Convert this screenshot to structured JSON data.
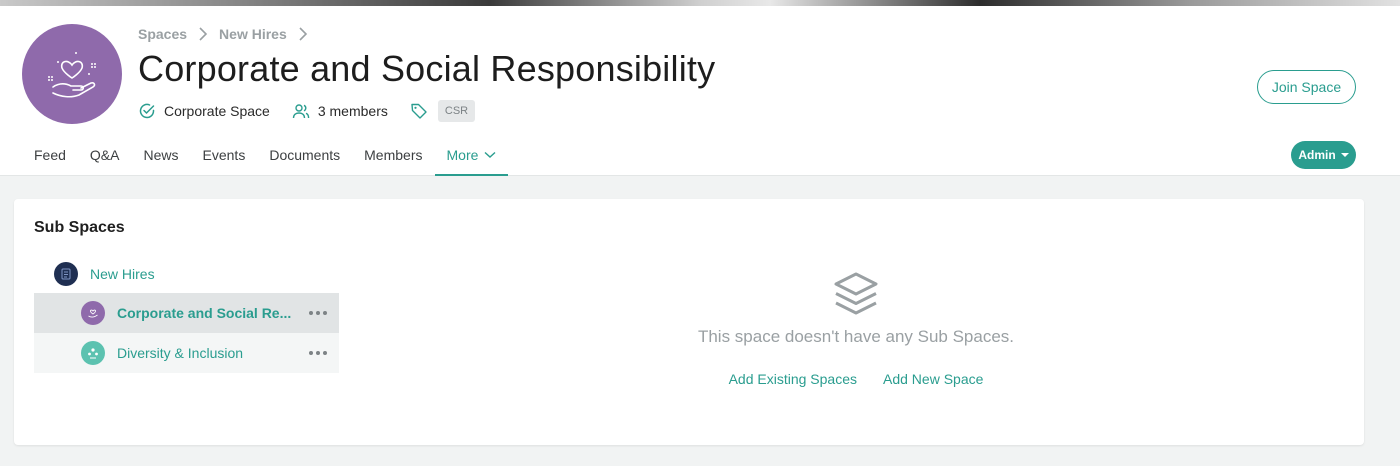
{
  "breadcrumb": {
    "items": [
      "Spaces",
      "New Hires"
    ]
  },
  "space": {
    "title": "Corporate and Social Responsibility",
    "type_label": "Corporate Space",
    "members_label": "3 members",
    "tag": "CSR",
    "join_label": "Join Space"
  },
  "tabs": [
    {
      "label": "Feed"
    },
    {
      "label": "Q&A"
    },
    {
      "label": "News"
    },
    {
      "label": "Events"
    },
    {
      "label": "Documents"
    },
    {
      "label": "Members"
    },
    {
      "label": "More",
      "active": true
    }
  ],
  "admin_label": "Admin",
  "sub_spaces": {
    "title": "Sub Spaces",
    "root": {
      "label": "New Hires",
      "icon": "new-hires-avatar"
    },
    "children": [
      {
        "label": "Corporate and Social Re...",
        "icon": "csr-avatar",
        "selected": true
      },
      {
        "label": "Diversity & Inclusion",
        "icon": "diversity-avatar",
        "selected": false
      }
    ],
    "empty_text": "This space doesn't have any Sub Spaces.",
    "add_existing": "Add Existing Spaces",
    "add_new": "Add New Space"
  },
  "colors": {
    "accent": "#2a9d8f",
    "avatar_purple": "#8f6aab",
    "muted": "#9aa0a3"
  }
}
